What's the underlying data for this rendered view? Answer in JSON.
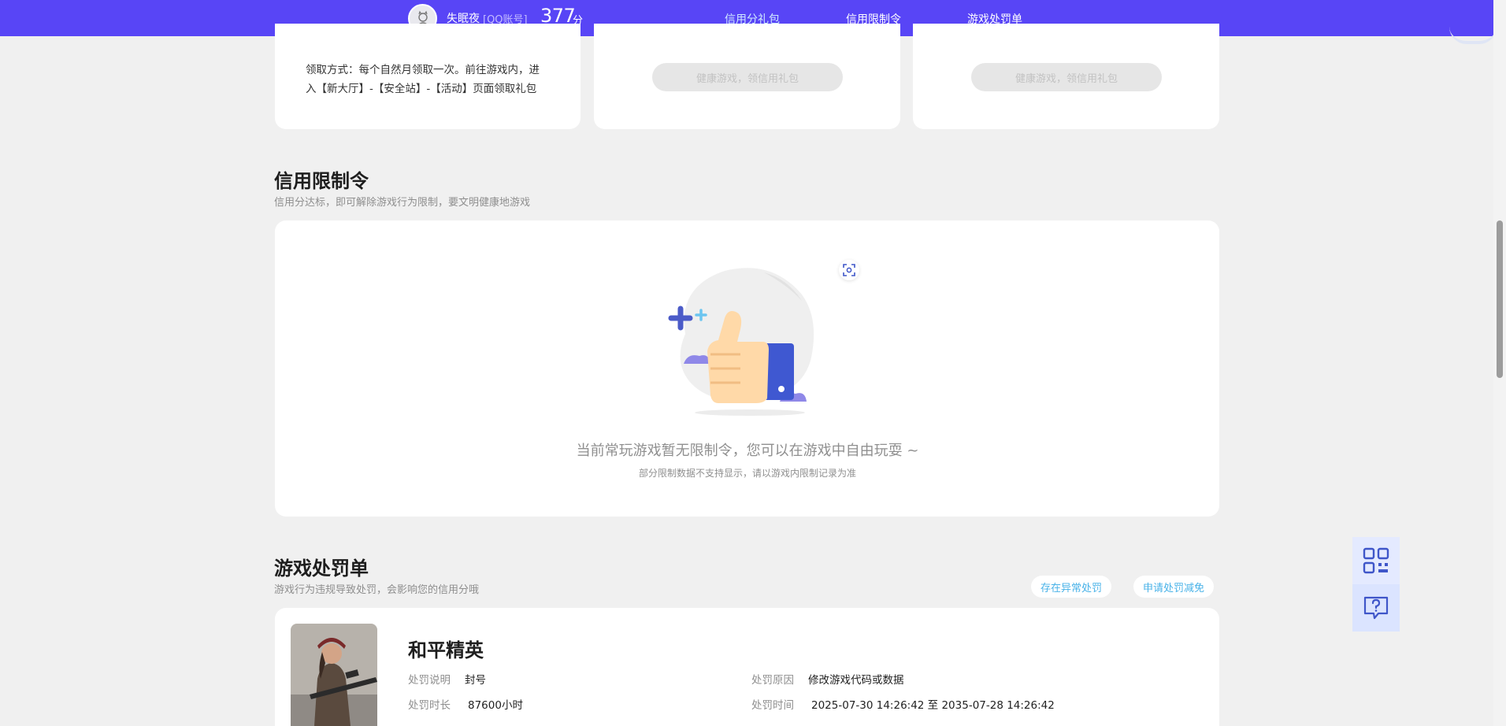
{
  "header": {
    "username": "失眠夜",
    "account_type": "[QQ账号]",
    "score": "377",
    "score_unit": "分",
    "tabs": [
      {
        "label": "信用分礼包",
        "active": true
      },
      {
        "label": "信用限制令",
        "active": false
      },
      {
        "label": "游戏处罚单",
        "active": false
      }
    ],
    "accent_color": "#5845f6"
  },
  "gift_cards": {
    "claim_desc_line1": "领取方式：每个自然月领取一次。前往游戏内，进",
    "claim_desc_line2": "入【新大厅】-【安全站】-【活动】页面领取礼包",
    "button_1": "健康游戏，领信用礼包",
    "button_2": "健康游戏，领信用礼包"
  },
  "restriction": {
    "title": "信用限制令",
    "subtitle": "信用分达标，即可解除游戏行为限制，要文明健康地游戏",
    "empty_message": "当前常玩游戏暂无限制令，您可以在游戏中自由玩耍 ~",
    "empty_note": "部分限制数据不支持显示，请以游戏内限制记录为准"
  },
  "penalty": {
    "title": "游戏处罚单",
    "subtitle": "游戏行为违规导致处罚，会影响您的信用分哦",
    "abnormal_btn": "存在异常处罚",
    "reduce_btn": "申请处罚减免",
    "game": {
      "name": "和平精英",
      "desc_label": "处罚说明",
      "desc_value": "封号",
      "reason_label": "处罚原因",
      "reason_value": "修改游戏代码或数据",
      "duration_label": "处罚时长",
      "duration_value": "87600小时",
      "time_label": "处罚时间",
      "time_value": "2025-07-30 14:26:42 至 2035-07-28 14:26:42"
    }
  },
  "floating": {
    "qr_icon": "qr-code-icon",
    "help_icon": "help-chat-icon"
  }
}
